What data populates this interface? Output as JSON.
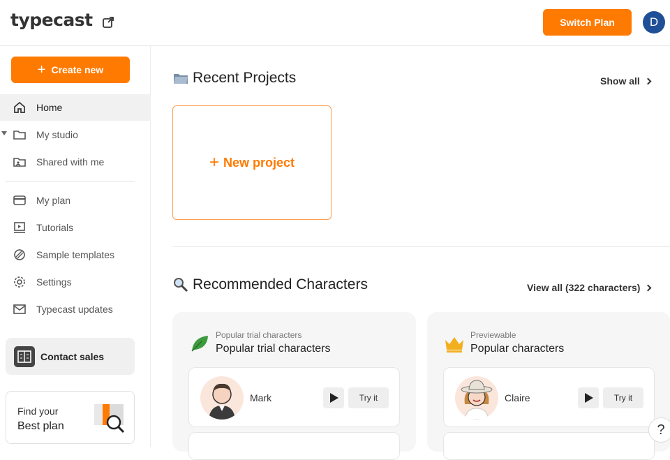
{
  "header": {
    "logo": "typecast",
    "switch_plan": "Switch Plan",
    "avatar_initial": "D",
    "avatar_color": "#1f4f97"
  },
  "sidebar": {
    "create_new": "Create new",
    "items": [
      {
        "label": "Home",
        "icon": "home-icon"
      },
      {
        "label": "My studio",
        "icon": "folder-icon"
      },
      {
        "label": "Shared with me",
        "icon": "shared-folder-icon"
      },
      {
        "label": "My plan",
        "icon": "card-icon"
      },
      {
        "label": "Tutorials",
        "icon": "video-icon"
      },
      {
        "label": "Sample templates",
        "icon": "template-icon"
      },
      {
        "label": "Settings",
        "icon": "gear-icon"
      },
      {
        "label": "Typecast updates",
        "icon": "mail-icon"
      }
    ],
    "contact_sales": "Contact sales",
    "best_plan_line1": "Find your",
    "best_plan_line2": "Best plan"
  },
  "recent": {
    "title": "Recent Projects",
    "show_all": "Show all",
    "new_project": "New project"
  },
  "recommended": {
    "title": "Recommended Characters",
    "view_all": "View all (322 characters)",
    "cards": [
      {
        "subtitle": "Popular trial characters",
        "title": "Popular trial characters",
        "icon": "leaf-icon",
        "character": {
          "name": "Mark",
          "try_label": "Try it"
        }
      },
      {
        "subtitle": "Previewable",
        "title": "Popular characters",
        "icon": "crown-icon",
        "character": {
          "name": "Claire",
          "try_label": "Try it"
        }
      }
    ]
  },
  "help_label": "?",
  "colors": {
    "accent": "#ff7a00"
  }
}
